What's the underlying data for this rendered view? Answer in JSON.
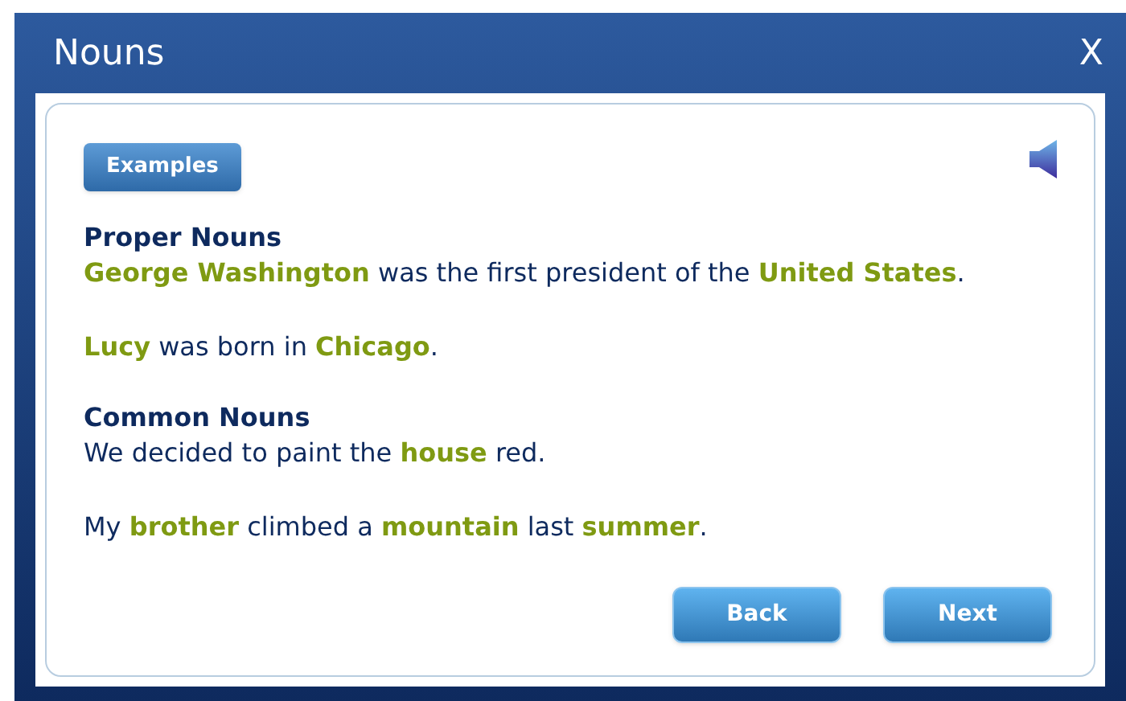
{
  "window": {
    "title": "Nouns",
    "close": "X"
  },
  "examples_button": "Examples",
  "sections": [
    {
      "heading": "Proper Nouns",
      "sentences": [
        "**George Washington** was the first president of the **United States**.",
        "**Lucy** was born in **Chicago**."
      ]
    },
    {
      "heading": "Common Nouns",
      "sentences": [
        "We decided to paint the **house** red.",
        "My **brother** climbed a **mountain** last **summer**."
      ]
    }
  ],
  "buttons": [
    "Back",
    "Next"
  ]
}
